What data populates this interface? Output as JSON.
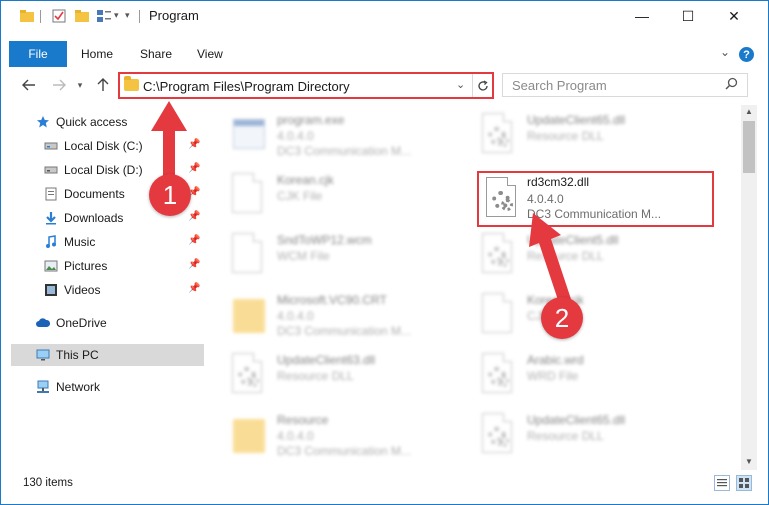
{
  "window": {
    "title": "Program",
    "controls": {
      "minimize": "—",
      "maximize": "☐",
      "close": "✕"
    }
  },
  "ribbon": {
    "tabs": [
      {
        "label": "File"
      },
      {
        "label": "Home"
      },
      {
        "label": "Share"
      },
      {
        "label": "View"
      }
    ]
  },
  "address": {
    "path": "C:\\Program Files\\Program Directory"
  },
  "search": {
    "placeholder": "Search Program"
  },
  "sidebar": {
    "items": [
      {
        "label": "Quick access",
        "icon": "star-icon"
      },
      {
        "label": "Local Disk (C:)",
        "icon": "drive-icon",
        "pinned": true
      },
      {
        "label": "Local Disk (D:)",
        "icon": "drive-icon",
        "pinned": true
      },
      {
        "label": "Documents",
        "icon": "documents-icon",
        "pinned": true
      },
      {
        "label": "Downloads",
        "icon": "downloads-icon",
        "pinned": true
      },
      {
        "label": "Music",
        "icon": "music-icon",
        "pinned": true
      },
      {
        "label": "Pictures",
        "icon": "pictures-icon",
        "pinned": true
      },
      {
        "label": "Videos",
        "icon": "videos-icon",
        "pinned": true
      },
      {
        "label": "OneDrive",
        "icon": "cloud-icon"
      },
      {
        "label": "This PC",
        "icon": "computer-icon",
        "selected": true
      },
      {
        "label": "Network",
        "icon": "network-icon"
      }
    ]
  },
  "files": {
    "left": [
      {
        "name": "program.exe",
        "line2": "4.0.4.0",
        "line3": "DC3 Communication M...",
        "kind": "exe"
      },
      {
        "name": "Korean.cjk",
        "line2": "CJK File",
        "line3": "",
        "kind": "doc"
      },
      {
        "name": "SndToWP12.wcm",
        "line2": "WCM File",
        "line3": "",
        "kind": "doc"
      },
      {
        "name": "Microsoft.VC90.CRT",
        "line2": "4.0.4.0",
        "line3": "DC3 Communication M...",
        "kind": "folder"
      },
      {
        "name": "UpdateClient63.dll",
        "line2": "Resource DLL",
        "line3": "",
        "kind": "dll"
      },
      {
        "name": "Resource",
        "line2": "4.0.4.0",
        "line3": "DC3 Communication M...",
        "kind": "folder"
      }
    ],
    "right": [
      {
        "name": "UpdateClient65.dll",
        "line2": "Resource DLL",
        "line3": "",
        "kind": "dll"
      },
      {
        "name": "rd3cm32.dll",
        "line2": "4.0.4.0",
        "line3": "DC3 Communication M...",
        "kind": "dll",
        "highlighted": true
      },
      {
        "name": "UpdateClient5.dll",
        "line2": "Resource DLL",
        "line3": "",
        "kind": "dll"
      },
      {
        "name": "Korean.cjk",
        "line2": "CJK File",
        "line3": "",
        "kind": "doc"
      },
      {
        "name": "Arabic.wrd",
        "line2": "WRD File",
        "line3": "",
        "kind": "dll"
      },
      {
        "name": "UpdateClient65.dll",
        "line2": "Resource DLL",
        "line3": "",
        "kind": "dll"
      }
    ]
  },
  "status": {
    "item_count": "130 items"
  },
  "annotations": {
    "step1": "1",
    "step2": "2",
    "color": "#e53940"
  },
  "colors": {
    "accent": "#1979ca",
    "highlight": "#e53940"
  }
}
